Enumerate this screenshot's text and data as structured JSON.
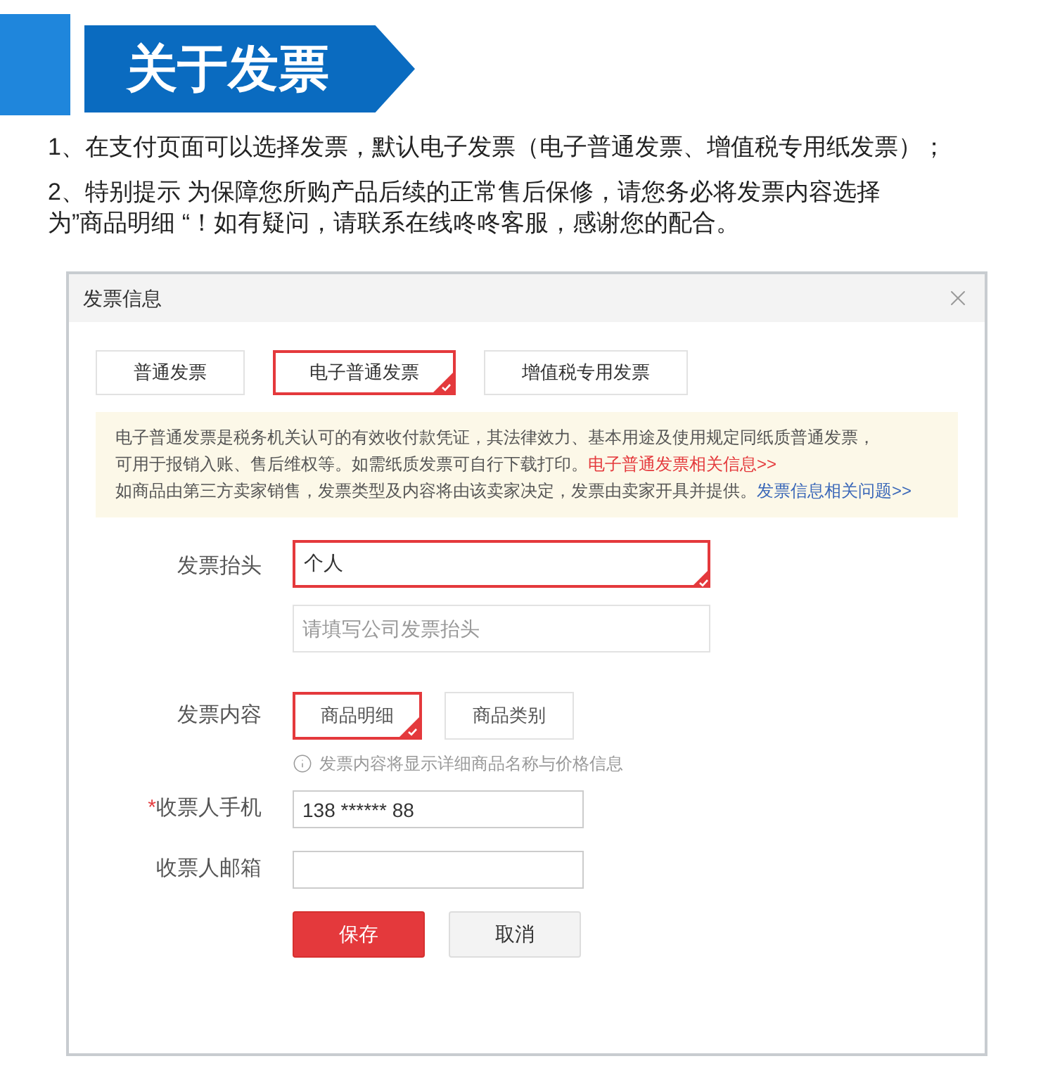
{
  "banner": {
    "title": "关于发票"
  },
  "notes": [
    {
      "lines": [
        "1、在支付页面可以选择发票，默认电子发票（电子普通发票、增值税专用纸发票）；"
      ]
    },
    {
      "lines": [
        "2、特别提示 为保障您所购产品后续的正常售后保修，请您务必将发票内容选择",
        "为”商品明细 “！如有疑问，请联系在线咚咚客服，感谢您的配合。"
      ]
    }
  ],
  "dialog": {
    "title": "发票信息",
    "tabs": [
      {
        "label": "普通发票",
        "selected": false
      },
      {
        "label": "电子普通发票",
        "selected": true
      },
      {
        "label": "增值税专用发票",
        "selected": false
      }
    ],
    "notice": [
      {
        "text": "电子普通发票是税务机关认可的有效收付款凭证，其法律效力、基本用途及使用规定同纸质普通发票，"
      },
      {
        "text": "可用于报销入账、售后维权等。如需纸质发票可自行下载打印。",
        "link": {
          "text": "电子普通发票相关信息>>",
          "color": "#e4393c"
        }
      },
      {
        "text": "如商品由第三方卖家销售，发票类型及内容将由该卖家决定，发票由卖家开具并提供。",
        "link": {
          "text": "发票信息相关问题>>",
          "color": "#3a67b8"
        }
      }
    ],
    "title_field": {
      "label": "发票抬头",
      "options": [
        {
          "value": "个人",
          "selected": true
        },
        {
          "placeholder": "请填写公司发票抬头",
          "selected": false
        }
      ]
    },
    "content_field": {
      "label": "发票内容",
      "options": [
        {
          "label": "商品明细",
          "selected": true
        },
        {
          "label": "商品类别",
          "selected": false
        }
      ],
      "hint": "发票内容将显示详细商品名称与价格信息"
    },
    "phone_field": {
      "label": "收票人手机",
      "required_mark": "*",
      "value": "138 ****** 88"
    },
    "email_field": {
      "label": "收票人邮箱"
    },
    "buttons": [
      {
        "label": "保存",
        "kind": "primary"
      },
      {
        "label": "取消",
        "kind": "secondary"
      }
    ]
  }
}
